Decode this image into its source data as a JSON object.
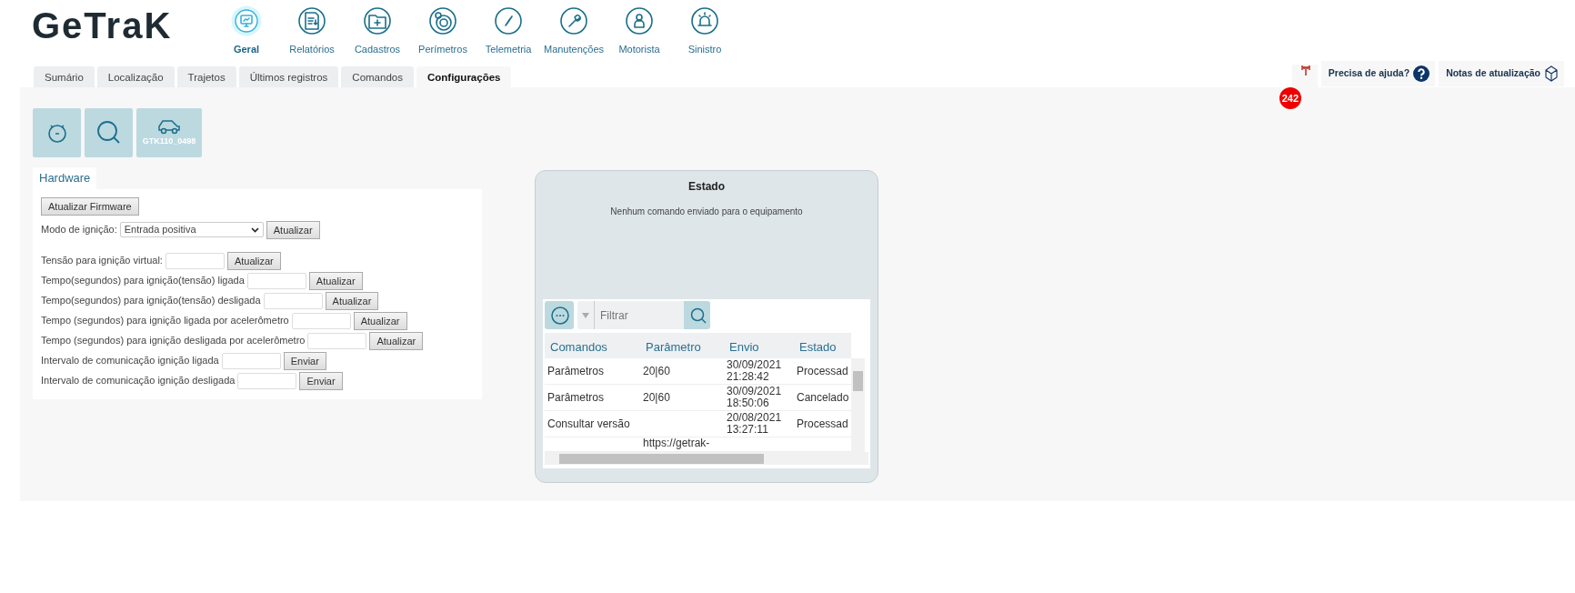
{
  "logo": {
    "text": "GeTraK"
  },
  "nav": [
    {
      "label": "Geral",
      "selected": true
    },
    {
      "label": "Relatórios",
      "selected": false
    },
    {
      "label": "Cadastros",
      "selected": false
    },
    {
      "label": "Perímetros",
      "selected": false
    },
    {
      "label": "Telemetria",
      "selected": false
    },
    {
      "label": "Manutenções",
      "selected": false
    },
    {
      "label": "Motorista",
      "selected": false
    },
    {
      "label": "Sinistro",
      "selected": false
    }
  ],
  "tabs": [
    {
      "label": "Sumário",
      "selected": false
    },
    {
      "label": "Localização",
      "selected": false
    },
    {
      "label": "Trajetos",
      "selected": false
    },
    {
      "label": "Últimos registros",
      "selected": false
    },
    {
      "label": "Comandos",
      "selected": false
    },
    {
      "label": "Configurações",
      "selected": true
    }
  ],
  "alerts": {
    "count": "242"
  },
  "help": {
    "label": "Precisa de ajuda?"
  },
  "release_notes": {
    "label": "Notas de atualização"
  },
  "device": {
    "label": "GTK110_0498"
  },
  "hardware": {
    "tab": "Hardware",
    "rows": [
      {
        "kind": "button",
        "button": "Atualizar Firmware"
      },
      {
        "kind": "select",
        "label": "Modo de ignição:",
        "value": "Entrada positiva",
        "button": "Atualizar"
      },
      {
        "kind": "input",
        "label": "Tensão para ignição virtual:",
        "button": "Atualizar"
      },
      {
        "kind": "input",
        "label": "Tempo(segundos) para ignição(tensão) ligada",
        "button": "Atualizar"
      },
      {
        "kind": "input",
        "label": "Tempo(segundos) para ignição(tensão) desligada",
        "button": "Atualizar"
      },
      {
        "kind": "input",
        "label": "Tempo (segundos) para ignição ligada por acelerômetro",
        "button": "Atualizar"
      },
      {
        "kind": "input",
        "label": "Tempo (segundos) para ignição desligada por acelerômetro",
        "button": "Atualizar"
      },
      {
        "kind": "input",
        "label": "Intervalo de comunicação ignição ligada",
        "button": "Enviar"
      },
      {
        "kind": "input",
        "label": "Intervalo de comunicação ignição desligada",
        "button": "Enviar"
      }
    ]
  },
  "status": {
    "title": "Estado",
    "message": "Nenhum comando enviado para o equipamento",
    "filter": {
      "placeholder": "Filtrar"
    },
    "columns": [
      "Comandos",
      "Parâmetro",
      "Envio",
      "Estado"
    ],
    "rows": [
      [
        "Parâmetros",
        "20|60",
        "30/09/2021 21:28:42",
        "Processad"
      ],
      [
        "Parâmetros",
        "20|60",
        "30/09/2021 18:50:06",
        "Cancelado"
      ],
      [
        "Consultar versão",
        "",
        "20/08/2021 13:27:11",
        "Processad"
      ],
      [
        "",
        "https://getrak-",
        "",
        ""
      ]
    ]
  }
}
